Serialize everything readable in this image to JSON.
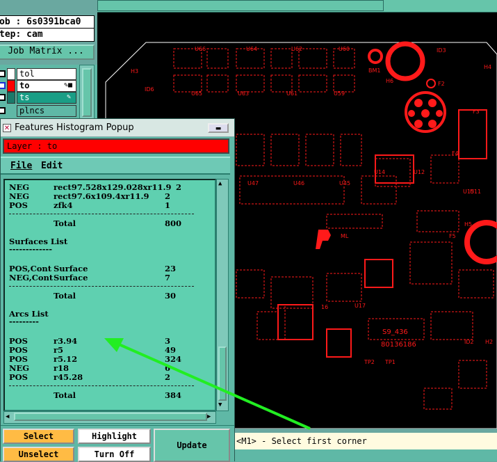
{
  "job": {
    "job_label": "ob : 6s0391bca0",
    "step_label": "tep: cam",
    "matrix_button": "Job Matrix ..."
  },
  "layers": [
    {
      "name": "tol",
      "color": "#ffffff",
      "row_bg": "#ffffff"
    },
    {
      "name": "to",
      "color": "#ff0000",
      "row_bg": "#ffffff"
    },
    {
      "name": "ts",
      "color": "#1a7a6a",
      "row_bg": "#1a9e86"
    },
    {
      "name": "plncs",
      "color": "#ffffff",
      "row_bg": "#5fb8a6"
    }
  ],
  "popup": {
    "title": "Features Histogram Popup",
    "layer_field": "Layer :  to",
    "menu": {
      "file": "File",
      "edit": "Edit"
    }
  },
  "rows": [
    {
      "pol": "NEG",
      "sym": "rect97.528x129.028xr11.9",
      "cnt": "2"
    },
    {
      "pol": "NEG",
      "sym": "rect97.6x109.4xr11.9",
      "cnt": "2"
    },
    {
      "pol": "POS",
      "sym": "zfk4",
      "cnt": "1"
    },
    {
      "pol": "",
      "sym": "Total",
      "cnt": "800"
    },
    {
      "pol": "Surfaces List",
      "sym": "",
      "cnt": ""
    },
    {
      "pol": "-------------",
      "sym": "",
      "cnt": ""
    },
    {
      "pol": "POS,Cont",
      "sym": "Surface",
      "cnt": "23"
    },
    {
      "pol": "NEG,Cont",
      "sym": "Surface",
      "cnt": "7"
    },
    {
      "pol": "",
      "sym": "Total",
      "cnt": "30"
    },
    {
      "pol": "Arcs List",
      "sym": "",
      "cnt": ""
    },
    {
      "pol": "---------",
      "sym": "",
      "cnt": ""
    },
    {
      "pol": "POS",
      "sym": "r3.94",
      "cnt": "3"
    },
    {
      "pol": "POS",
      "sym": "r5",
      "cnt": "49"
    },
    {
      "pol": "POS",
      "sym": "r5.12",
      "cnt": "324"
    },
    {
      "pol": "NEG",
      "sym": "r18",
      "cnt": "6"
    },
    {
      "pol": "POS",
      "sym": "r45.28",
      "cnt": "2"
    },
    {
      "pol": "",
      "sym": "Total",
      "cnt": "384"
    }
  ],
  "buttons": {
    "select": "Select",
    "unselect": "Unselect",
    "highlight": "Highlight",
    "turn_off": "Turn Off",
    "update": "Update"
  },
  "status": {
    "message": "<M1> - Select first corner"
  },
  "board_labels": {
    "u66": "U66",
    "u64": "U64",
    "u62": "U62",
    "u60": "U60",
    "id3": "ID3",
    "h3": "H3",
    "bm1": "BM1",
    "h6": "H6",
    "h4": "H4",
    "id6": "ID6",
    "u65": "U65",
    "u63": "U63",
    "u61": "U61",
    "u59": "U59",
    "f2": "F2",
    "f3": "F3",
    "f4": "F4",
    "u14": "U14",
    "u12": "U12",
    "u15": "U15",
    "u11": "U11",
    "u47": "U47",
    "u46": "U46",
    "u45": "U45",
    "h5": "H5",
    "f5": "F5",
    "u17": "U17",
    "n16": "16",
    "s9": "S9_436",
    "n80": "80136186",
    "tp2": "TP2",
    "tp1": "TP1",
    "h2": "H2",
    "id2": "ID2",
    "ml": "ML"
  },
  "colors": {
    "board_bg": "#000000",
    "trace": "#ff1a1a",
    "arrow": "#22ee22",
    "teal": "#5fb8a6"
  }
}
